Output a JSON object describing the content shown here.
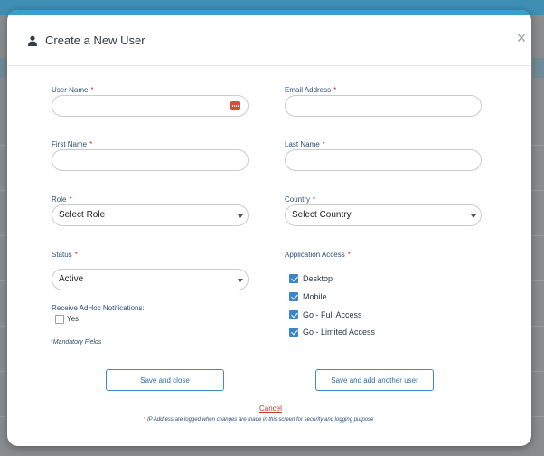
{
  "modal": {
    "title": "Create a New User",
    "close_glyph": "×"
  },
  "form": {
    "user_name": {
      "label": "User Name",
      "value": "",
      "placeholder": ""
    },
    "email": {
      "label": "Email Address",
      "value": "",
      "placeholder": ""
    },
    "first_name": {
      "label": "First Name",
      "value": "",
      "placeholder": ""
    },
    "last_name": {
      "label": "Last Name",
      "value": "",
      "placeholder": ""
    },
    "role": {
      "label": "Role",
      "selected": "Select Role"
    },
    "country": {
      "label": "Country",
      "selected": "Select Country"
    },
    "status": {
      "label": "Status",
      "selected": "Active"
    },
    "application_access": {
      "label": "Application Access",
      "options": [
        {
          "label": "Desktop",
          "checked": true
        },
        {
          "label": "Mobile",
          "checked": true
        },
        {
          "label": "Go - Full Access",
          "checked": true
        },
        {
          "label": "Go - Limited Access",
          "checked": true
        }
      ]
    },
    "adhoc": {
      "label": "Receive AdHoc Notifications:",
      "option_label": "Yes",
      "checked": false
    },
    "required_marker": "*",
    "mandatory_note": "Mandatory Fields"
  },
  "actions": {
    "save_close": "Save and close",
    "save_add": "Save and add another user",
    "cancel": "Cancel"
  },
  "footnote": "IP Address are logged when changes are made in this screen for security and logging purpose",
  "colors": {
    "accent": "#3a9ed0",
    "label": "#2d4f73",
    "required": "#d12f2f",
    "button_border": "#3a8fc6"
  }
}
